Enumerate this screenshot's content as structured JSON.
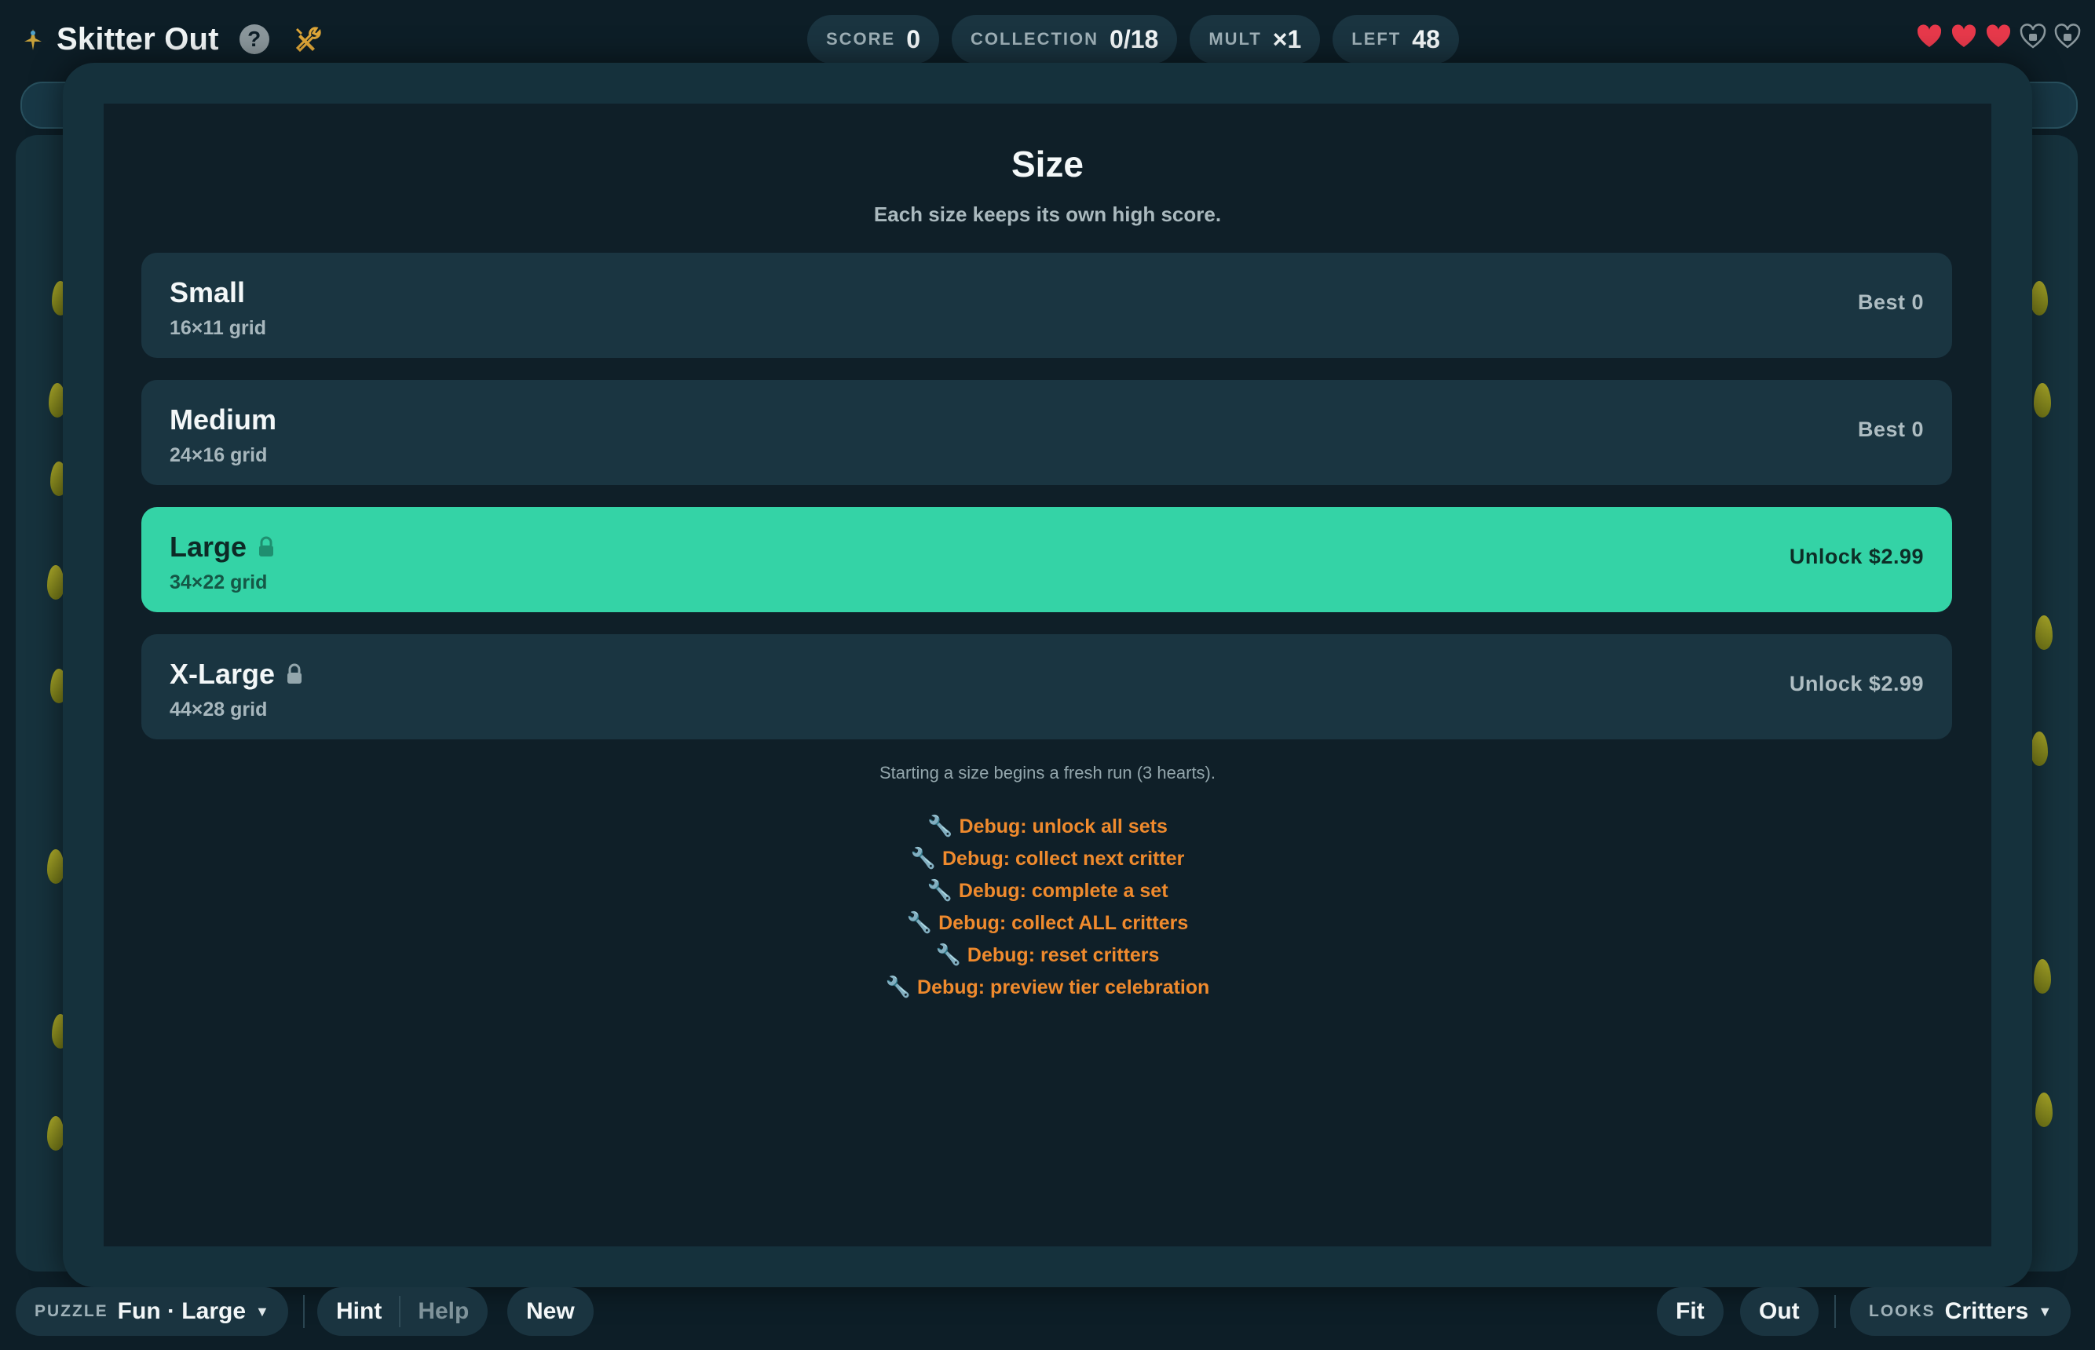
{
  "app": {
    "title": "Skitter Out",
    "help_icon": "?",
    "logo_icon": "bug-logo-icon",
    "tools_icon": "tools-icon"
  },
  "stats": [
    {
      "label": "SCORE",
      "value": "0"
    },
    {
      "label": "COLLECTION",
      "value": "0/18"
    },
    {
      "label": "MULT",
      "value": "×1"
    },
    {
      "label": "LEFT",
      "value": "48"
    }
  ],
  "hearts": {
    "filled": 3,
    "total": 5,
    "filled_color": "#e8394b"
  },
  "modal": {
    "title": "Size",
    "subtitle": "Each size keeps its own high score.",
    "sizes": [
      {
        "name": "Small",
        "grid": "16×11 grid",
        "right": "Best 0",
        "locked": false,
        "active": false
      },
      {
        "name": "Medium",
        "grid": "24×16 grid",
        "right": "Best 0",
        "locked": false,
        "active": false
      },
      {
        "name": "Large",
        "grid": "34×22 grid",
        "right": "Unlock $2.99",
        "locked": true,
        "active": true
      },
      {
        "name": "X-Large",
        "grid": "44×28 grid",
        "right": "Unlock $2.99",
        "locked": true,
        "active": false
      }
    ],
    "note": "Starting a size begins a fresh run (3 hearts).",
    "debug": [
      "Debug: unlock all sets",
      "Debug: collect next critter",
      "Debug: complete a set",
      "Debug: collect ALL critters",
      "Debug: reset critters",
      "Debug: preview tier celebration"
    ],
    "debug_icon": "wrench-icon",
    "accent_color": "#34d3a6",
    "debug_color": "#ef8a2d"
  },
  "bottom": {
    "puzzle_label": "PUZZLE",
    "puzzle_value": "Fun · Large",
    "hint": "Hint",
    "help": "Help",
    "new": "New",
    "fit": "Fit",
    "out": "Out",
    "looks_label": "LOOKS",
    "looks_value": "Critters",
    "caret": "▼"
  }
}
